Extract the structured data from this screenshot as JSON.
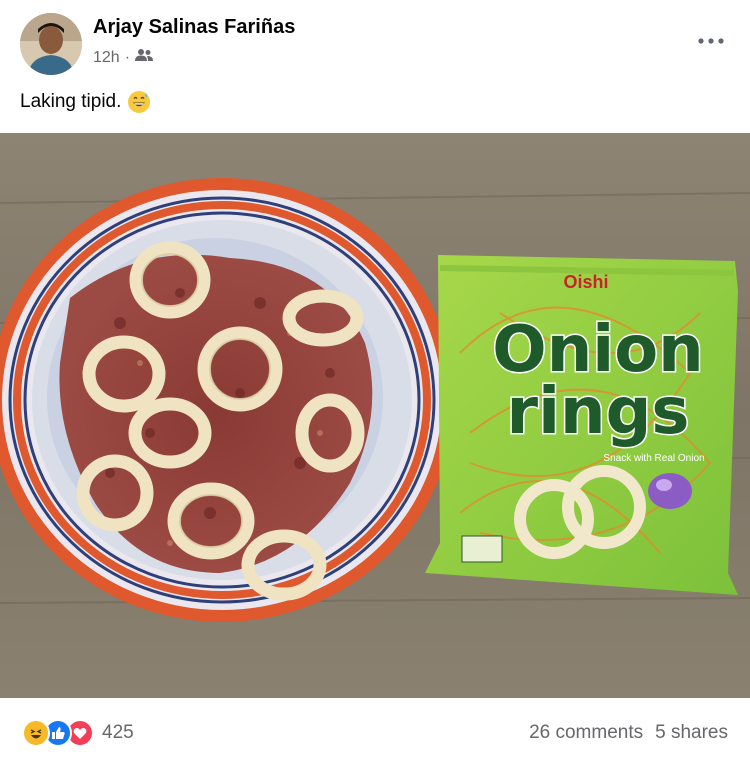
{
  "post": {
    "author": "Arjay Salinas Fariñas",
    "time": "12h",
    "separator": "·",
    "audience_icon": "friends-icon",
    "caption": "Laking tipid.",
    "caption_emoji": "grinning-sweat-emoji"
  },
  "photo": {
    "bag_brand_top": "Oishi",
    "bag_title_line1": "Onion",
    "bag_title_line2": "rings",
    "bag_subtitle": "Snack with Real Onion"
  },
  "footer": {
    "reaction_icons": [
      "haha-icon",
      "like-icon",
      "love-icon"
    ],
    "reaction_count": "425",
    "comments": "26 comments",
    "shares": "5 shares"
  },
  "colors": {
    "secondary_text": "#65676b",
    "like_blue": "#1877f2",
    "love_red": "#f33e58",
    "haha_yellow": "#f7b928"
  }
}
